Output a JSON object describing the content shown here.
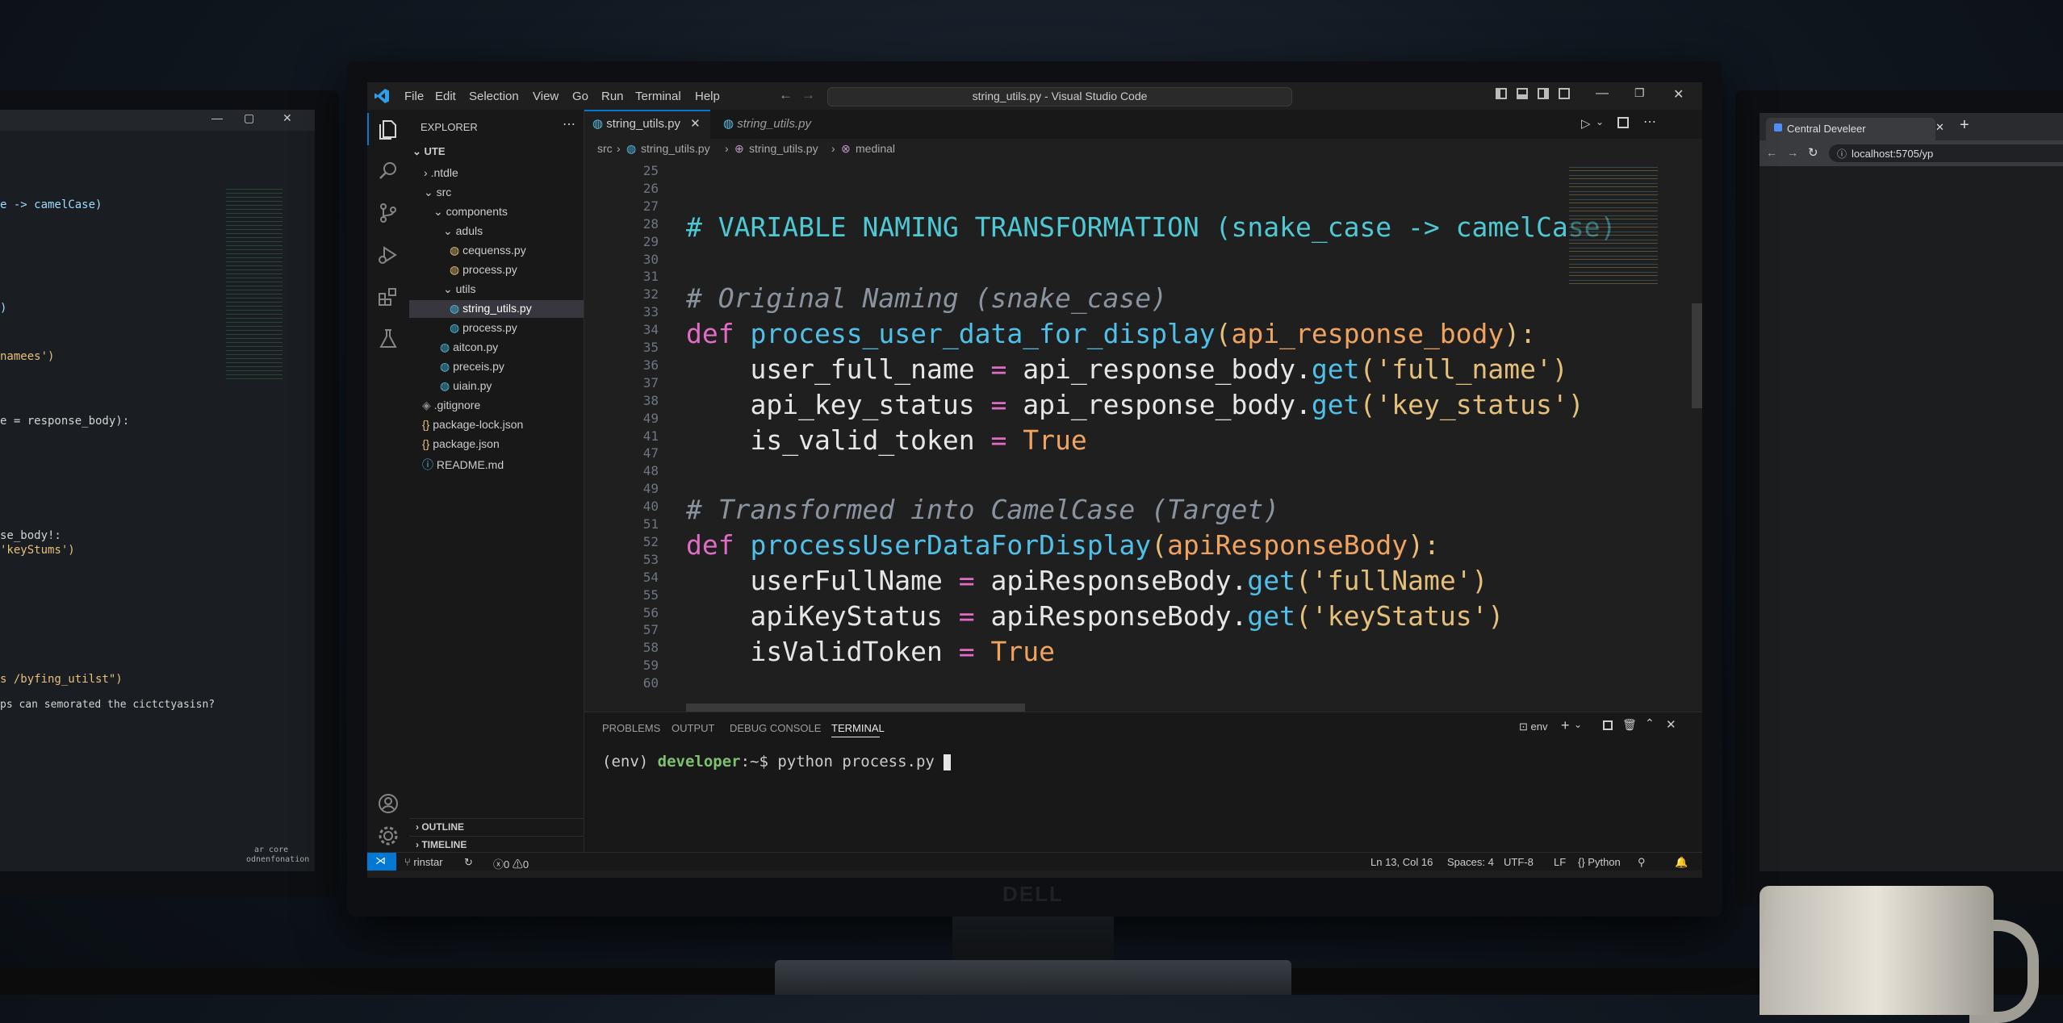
{
  "window": {
    "title": "string_utils.py - Visual Studio Code"
  },
  "menu": [
    "File",
    "Edit",
    "Selection",
    "View",
    "Go",
    "Run",
    "Terminal",
    "Help"
  ],
  "sidebar": {
    "header": "EXPLORER",
    "root": "UTE",
    "items": [
      {
        "label": ".ntdle",
        "kind": "folder"
      },
      {
        "label": "src",
        "kind": "folder-open"
      },
      {
        "label": "components",
        "kind": "folder-open"
      },
      {
        "label": "aduls",
        "kind": "folder-open"
      },
      {
        "label": "cequenss.py",
        "kind": "py"
      },
      {
        "label": "process.py",
        "kind": "py"
      },
      {
        "label": "utils",
        "kind": "folder-open"
      },
      {
        "label": "string_utils.py",
        "kind": "py",
        "selected": true
      },
      {
        "label": "process.py",
        "kind": "py"
      },
      {
        "label": "aitcon.py",
        "kind": "py"
      },
      {
        "label": "preceis.py",
        "kind": "py"
      },
      {
        "label": "uiain.py",
        "kind": "py"
      },
      {
        "label": ".gitignore",
        "kind": "git"
      },
      {
        "label": "package-lock.json",
        "kind": "json"
      },
      {
        "label": "package.json",
        "kind": "json"
      },
      {
        "label": "README.md",
        "kind": "info"
      }
    ],
    "outline": "OUTLINE",
    "timeline": "TIMELINE"
  },
  "tabs": [
    {
      "label": "string_utils.py",
      "active": true
    },
    {
      "label": "string_utils.py",
      "active": false,
      "preview": true
    }
  ],
  "breadcrumb": [
    "src",
    "string_utils.py",
    "string_utils.py",
    "medinal"
  ],
  "editor": {
    "line_numbers": [
      "25",
      "26",
      "27",
      "28",
      "29",
      "30",
      "31",
      "32",
      "33",
      "34",
      "35",
      "36",
      "37",
      "38",
      "49",
      "41",
      "47",
      "48",
      "49",
      "40",
      "51",
      "52",
      "53",
      "54",
      "55",
      "56",
      "57",
      "58",
      "59",
      "60"
    ],
    "lines": {
      "l27": "# VARIABLE NAMING TRANSFORMATION (snake_case -> camelCase)",
      "l31": "# Original Naming (snake_case)",
      "l33_def": "def ",
      "l33_fn": "process_user_data_for_display",
      "l33_p1": "(",
      "l33_arg": "api_response_body",
      "l33_p2": "):",
      "l35_var": "    user_full_name ",
      "l35_eq": "= ",
      "l35_obj": "api_response_body.",
      "l35_get": "get",
      "l35_str": "('full_name')",
      "l37_var": "    api_key_status ",
      "l37_eq": "= ",
      "l37_obj": "api_response_body.",
      "l37_get": "get",
      "l37_str": "('key_status')",
      "l41_var": "    is_valid_token ",
      "l41_eq": "= ",
      "l41_true": "True",
      "l49": "# Transformed into CamelCase (Target)",
      "l51_def": "def ",
      "l51_fn": "processUserDataForDisplay",
      "l51_p1": "(",
      "l51_arg": "apiResponseBody",
      "l51_p2": "):",
      "l53_var": "    userFullName ",
      "l53_eq": "= ",
      "l53_obj": "apiResponseBody.",
      "l53_get": "get",
      "l53_str": "('fullName')",
      "l55_var": "    apiKeyStatus ",
      "l55_eq": "= ",
      "l55_obj": "apiResponseBody.",
      "l55_get": "get",
      "l55_str": "('keyStatus')",
      "l57_var": "    isValidToken ",
      "l57_eq": "= ",
      "l57_true": "True"
    }
  },
  "panel": {
    "tabs": [
      "PROBLEMS",
      "OUTPUT",
      "DEBUG CONSOLE",
      "TERMINAL"
    ],
    "active_tab": "TERMINAL",
    "terminal_label": "env",
    "prompt_env": "(env) ",
    "prompt_user": "developer",
    "prompt_path": ":~$ ",
    "command": "python process.py "
  },
  "statusbar": {
    "branch": "rinstar",
    "problems": "0",
    "warnings": "0",
    "position": "Ln 13, Col 16",
    "spaces": "Spaces: 4",
    "encoding": "UTF-8",
    "eol": "LF",
    "language": "Python"
  },
  "left_monitor": {
    "lines": [
      "e -> camelCase)",
      ")",
      "namees')",
      "e = response_body):",
      "se_body!:",
      "'keyStums')",
      "s /byfing_utilst\")",
      "ps can semorated the cictctyasisn?",
      "ar core",
      "odnenfonation"
    ]
  },
  "right_monitor": {
    "tab_title": "Central Develeer",
    "address": "localhost:5705/yp",
    "new_tab": "+"
  },
  "monitor_brand": "DELL",
  "colors": {
    "keyword": "#e06cc3",
    "function": "#4fc1e9",
    "param": "#f0a35e",
    "string": "#e5c07b",
    "comment": "#8b949e",
    "heading": "#4ec9d4",
    "accent": "#0078d4"
  }
}
